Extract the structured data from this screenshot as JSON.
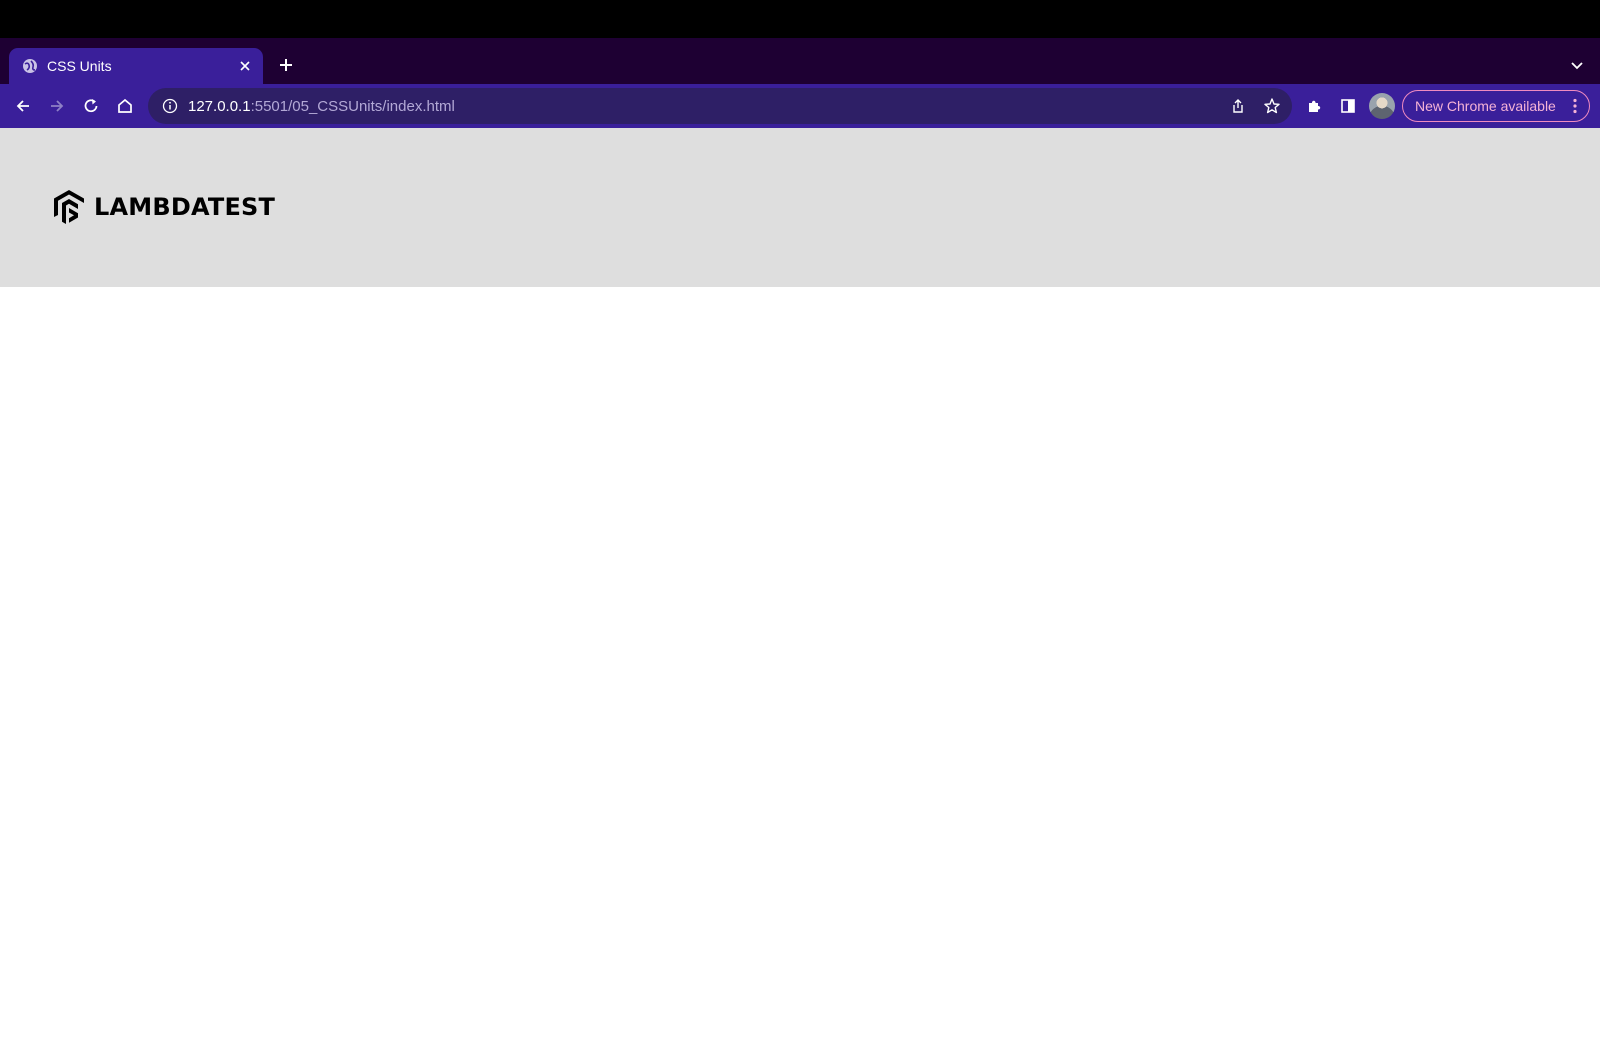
{
  "browser": {
    "tab": {
      "title": "CSS Units"
    },
    "address": {
      "host": "127.0.0.1",
      "rest": ":5501/05_CSSUnits/index.html"
    },
    "update_label": "New Chrome available"
  },
  "site": {
    "logo_text": "LAMBDATEST"
  },
  "colors": {
    "tab_active": "#3a1f9a",
    "tabstrip": "#1e0033",
    "header_bg": "#dedede",
    "pill_border": "#f08bc0"
  }
}
